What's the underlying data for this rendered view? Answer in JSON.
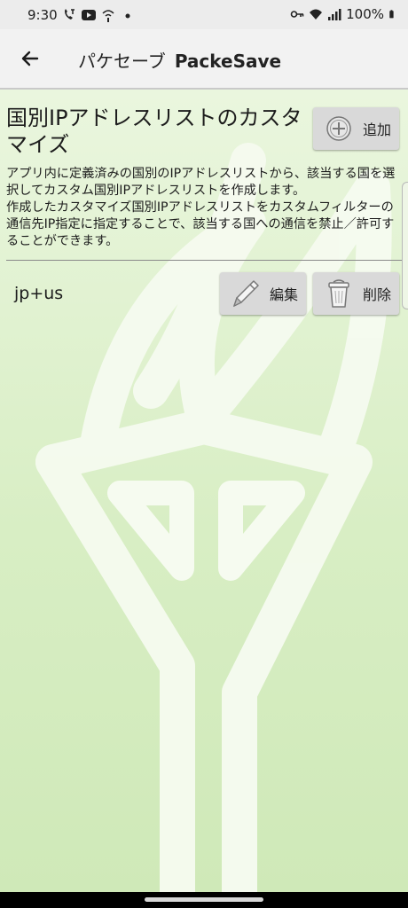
{
  "status_bar": {
    "time": "9:30",
    "battery": "100%",
    "left_icons": [
      "wifi-call-icon",
      "youtube-icon",
      "wifi-assist-icon",
      "dot-icon"
    ],
    "right_icons": [
      "vpn-key-icon",
      "wifi-icon",
      "signal-icon",
      "battery-icon"
    ]
  },
  "app_bar": {
    "title": "パケセーブ",
    "subtitle": "PackeSave",
    "back_icon": "arrow-back-icon"
  },
  "page": {
    "title": "国別IPアドレスリストのカスタマイズ",
    "add_button_label": "追加",
    "description": "アプリ内に定義済みの国別のIPアドレスリストから、該当する国を選択してカスタム国別IPアドレスリストを作成します。\n作成したカスタマイズ国別IPアドレスリストをカスタムフィルターの通信先IP指定に指定することで、該当する国への通信を禁止／許可することができます。"
  },
  "list": {
    "items": [
      {
        "name": "jp+us",
        "edit_label": "編集",
        "delete_label": "削除"
      }
    ]
  },
  "colors": {
    "background_top": "#eaf6de",
    "background_bottom": "#cfe9b8",
    "button": "#d9d9d9",
    "app_bar": "#f2f2f2",
    "status_bar": "#ececec"
  }
}
